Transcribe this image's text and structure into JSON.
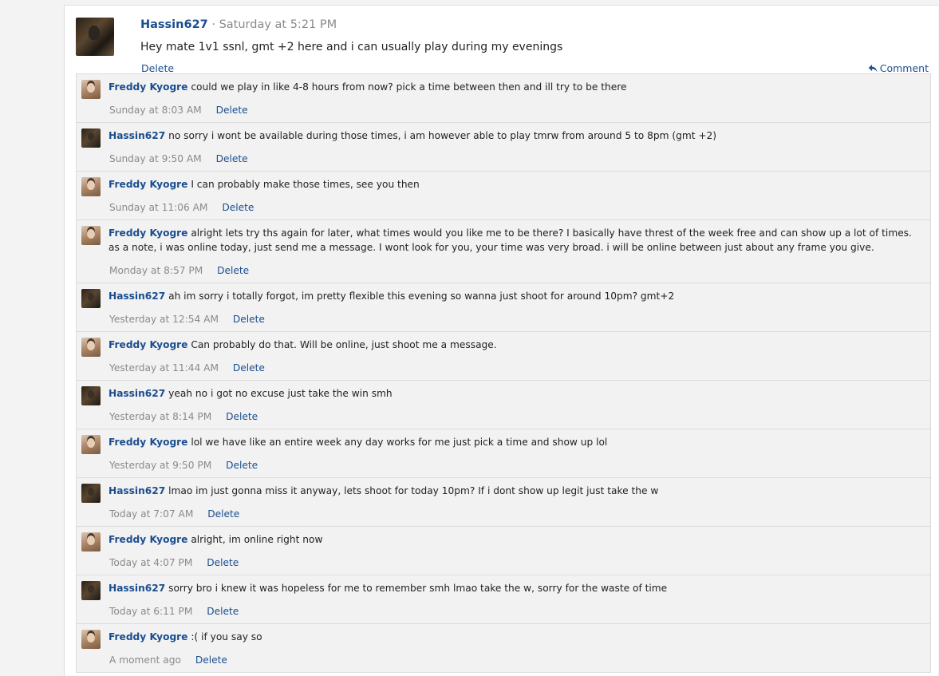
{
  "post": {
    "author": "Hassin627",
    "separator": "·",
    "time": "Saturday at 5:21 PM",
    "text": "Hey mate 1v1 ssnl, gmt +2 here and i can usually play during my evenings",
    "delete_label": "Delete",
    "comment_label": "Comment",
    "comment_icon": "reply-icon"
  },
  "comments": [
    {
      "author": "Freddy Kyogre",
      "avatar": "freddy",
      "text": "could we play in like 4-8 hours from now? pick a time between then and ill try to be there",
      "time": "Sunday at 8:03 AM",
      "delete": "Delete"
    },
    {
      "author": "Hassin627",
      "avatar": "hassin",
      "text": "no sorry i wont be available during those times, i am however able to play tmrw from around 5 to 8pm (gmt +2)",
      "time": "Sunday at 9:50 AM",
      "delete": "Delete"
    },
    {
      "author": "Freddy Kyogre",
      "avatar": "freddy",
      "text": "I can probably make those times, see you then",
      "time": "Sunday at 11:06 AM",
      "delete": "Delete"
    },
    {
      "author": "Freddy Kyogre",
      "avatar": "freddy",
      "text": "alright lets try ths again for later, what times would you like me to be there? I basically have threst of the week free and can show up a lot of times. as a note, i was online today, just send me a message. I wont look for you, your time was very broad. i will be online between just about any frame you give.",
      "time": "Monday at 8:57 PM",
      "delete": "Delete"
    },
    {
      "author": "Hassin627",
      "avatar": "hassin",
      "text": "ah im sorry i totally forgot, im pretty flexible this evening so wanna just shoot for around 10pm? gmt+2",
      "time": "Yesterday at 12:54 AM",
      "delete": "Delete"
    },
    {
      "author": "Freddy Kyogre",
      "avatar": "freddy",
      "text": "Can probably do that. Will be online, just shoot me a message.",
      "time": "Yesterday at 11:44 AM",
      "delete": "Delete"
    },
    {
      "author": "Hassin627",
      "avatar": "hassin",
      "text": "yeah no i got no excuse just take the win smh",
      "time": "Yesterday at 8:14 PM",
      "delete": "Delete"
    },
    {
      "author": "Freddy Kyogre",
      "avatar": "freddy",
      "text": "lol we have like an entire week any day works for me just pick a time and show up lol",
      "time": "Yesterday at 9:50 PM",
      "delete": "Delete"
    },
    {
      "author": "Hassin627",
      "avatar": "hassin",
      "text": "lmao im just gonna miss it anyway, lets shoot for today 10pm? If i dont show up legit just take the w",
      "time": "Today at 7:07 AM",
      "delete": "Delete"
    },
    {
      "author": "Freddy Kyogre",
      "avatar": "freddy",
      "text": "alright, im online right now",
      "time": "Today at 4:07 PM",
      "delete": "Delete"
    },
    {
      "author": "Hassin627",
      "avatar": "hassin",
      "text": "sorry bro i knew it was hopeless for me to remember smh lmao take the w, sorry for the waste of time",
      "time": "Today at 6:11 PM",
      "delete": "Delete"
    },
    {
      "author": "Freddy Kyogre",
      "avatar": "freddy",
      "text": ":( if you say so",
      "time": "A moment ago",
      "delete": "Delete"
    }
  ]
}
